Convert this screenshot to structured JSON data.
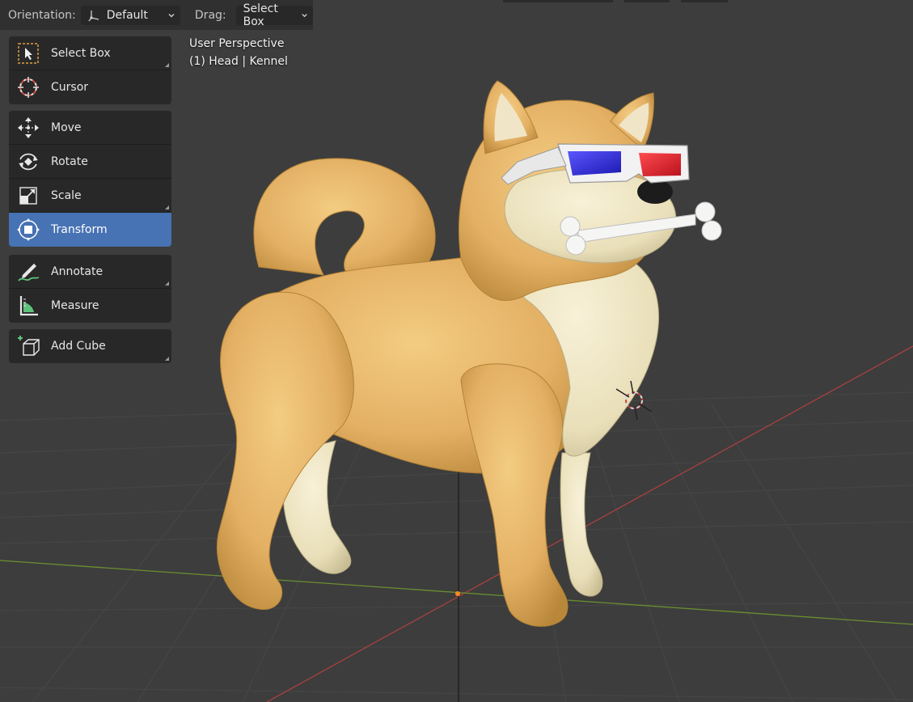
{
  "header": {
    "orientation_label": "Orientation:",
    "orientation_value": "Default",
    "drag_label": "Drag:",
    "drag_value": "Select Box"
  },
  "viewport": {
    "view_name": "User Perspective",
    "object_info": "(1) Head | Kennel"
  },
  "toolbar": {
    "groups": [
      {
        "tools": [
          {
            "label": "Select Box",
            "icon": "select-box-icon",
            "has_submenu": true
          },
          {
            "label": "Cursor",
            "icon": "cursor-icon",
            "has_submenu": false
          }
        ]
      },
      {
        "tools": [
          {
            "label": "Move",
            "icon": "move-icon",
            "has_submenu": false
          },
          {
            "label": "Rotate",
            "icon": "rotate-icon",
            "has_submenu": false
          },
          {
            "label": "Scale",
            "icon": "scale-icon",
            "has_submenu": true
          },
          {
            "label": "Transform",
            "icon": "transform-icon",
            "has_submenu": false,
            "active": true
          }
        ]
      },
      {
        "tools": [
          {
            "label": "Annotate",
            "icon": "annotate-icon",
            "has_submenu": true
          },
          {
            "label": "Measure",
            "icon": "measure-icon",
            "has_submenu": false
          }
        ]
      },
      {
        "tools": [
          {
            "label": "Add Cube",
            "icon": "add-cube-icon",
            "has_submenu": true
          }
        ]
      }
    ]
  },
  "colors": {
    "viewport_bg": "#3d3d3d",
    "panel_bg": "#282828",
    "active_tool": "#4772b3",
    "dog_fur": "#e8b96a",
    "dog_cream": "#efe6c4",
    "axis_x": "#a8403f",
    "axis_y": "#6b8f2f"
  }
}
